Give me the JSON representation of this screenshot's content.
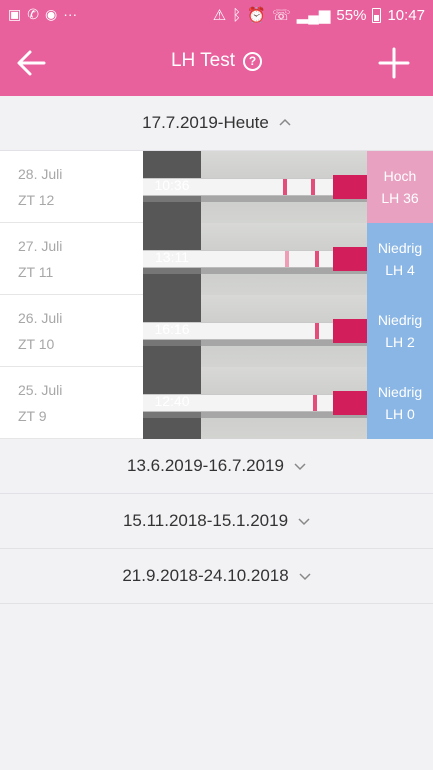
{
  "status_bar": {
    "battery": "55%",
    "time": "10:47"
  },
  "app_bar": {
    "title": "LH Test",
    "help_icon": "?"
  },
  "groups": [
    {
      "label": "17.7.2019-Heute",
      "entries": [
        {
          "date": "28. Juli",
          "cycle_day": "ZT 12",
          "time": "10:36",
          "level": "Hoch",
          "lh": "LH 36",
          "color": "#e8a1c1"
        },
        {
          "date": "27. Juli",
          "cycle_day": "ZT 11",
          "time": "13:11",
          "level": "Niedrig",
          "lh": "LH 4",
          "color": "#8ab6e5"
        },
        {
          "date": "26. Juli",
          "cycle_day": "ZT 10",
          "time": "16:16",
          "level": "Niedrig",
          "lh": "LH 2",
          "color": "#8ab6e5"
        },
        {
          "date": "25. Juli",
          "cycle_day": "ZT 9",
          "time": "12:40",
          "level": "Niedrig",
          "lh": "LH 0",
          "color": "#8ab6e5"
        }
      ]
    },
    {
      "label": "13.6.2019-16.7.2019"
    },
    {
      "label": "15.11.2018-15.1.2019"
    },
    {
      "label": "21.9.2018-24.10.2018"
    }
  ],
  "colors": {
    "accent": "#e8609c",
    "high": "#e8a1c1",
    "low": "#8ab6e5"
  }
}
